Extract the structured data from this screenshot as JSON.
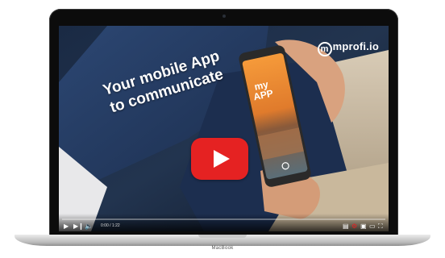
{
  "device": {
    "brand_label": "MacBook"
  },
  "video": {
    "logo": "mprofi.io",
    "headline": [
      "Your mobile App",
      "to communicate"
    ],
    "phone_app_label": [
      "my",
      "APP"
    ],
    "player": {
      "time": "0:00 / 1:22",
      "progress": 0,
      "accent_color": "#e52222"
    }
  },
  "icons": [
    "play-icon",
    "next-icon",
    "volume-icon",
    "subtitles-icon",
    "settings-icon",
    "miniplayer-icon",
    "theater-icon",
    "fullscreen-icon"
  ]
}
